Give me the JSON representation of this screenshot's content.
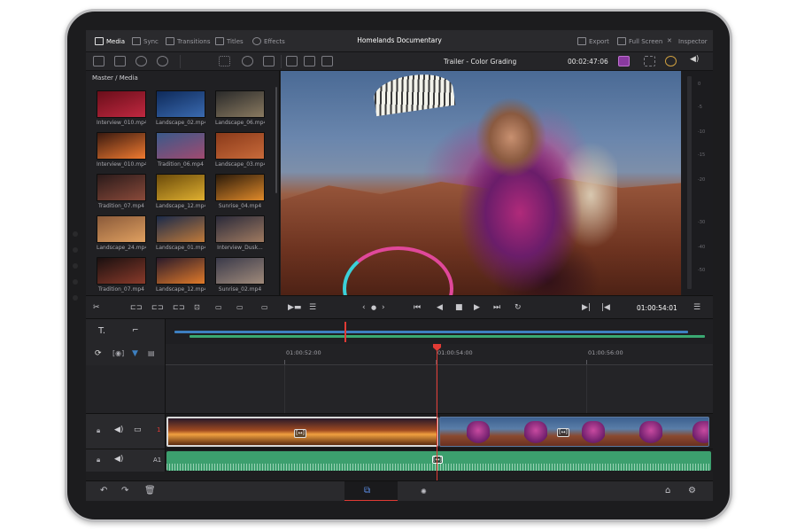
{
  "header": {
    "tabs": [
      {
        "label": "Media",
        "icon": "media-icon",
        "active": true
      },
      {
        "label": "Sync",
        "icon": "sync-icon"
      },
      {
        "label": "Transitions",
        "icon": "transitions-icon"
      },
      {
        "label": "Titles",
        "icon": "titles-icon"
      },
      {
        "label": "Effects",
        "icon": "effects-icon"
      }
    ],
    "project_title": "Homelands Documentary",
    "actions": [
      {
        "label": "Export",
        "icon": "export-icon"
      },
      {
        "label": "Full Screen",
        "icon": "fullscreen-icon"
      },
      {
        "label": "Inspector",
        "icon": "inspector-icon"
      }
    ]
  },
  "viewer": {
    "timeline_name": "Trailer - Color Grading",
    "duration": "00:02:47:06",
    "current_timecode": "01:00:54:01"
  },
  "media_pool": {
    "breadcrumb": "Master / Media",
    "clips": [
      {
        "name": "Interview_010.mp4",
        "colors": [
          "#6a0e1a",
          "#c02840"
        ]
      },
      {
        "name": "Landscape_02.mp4",
        "colors": [
          "#0e2a5a",
          "#3a6ab0"
        ]
      },
      {
        "name": "Landscape_06.mp4",
        "colors": [
          "#2a2a2a",
          "#8a7a60"
        ]
      },
      {
        "name": "Interview_010.mp4",
        "colors": [
          "#3a1a10",
          "#f07a30"
        ]
      },
      {
        "name": "Tradition_06.mp4",
        "colors": [
          "#3a5a8a",
          "#a04a70"
        ]
      },
      {
        "name": "Landscape_03.mp4",
        "colors": [
          "#8a3a1a",
          "#c86a3a"
        ]
      },
      {
        "name": "Tradition_07.mp4",
        "colors": [
          "#2a1a1a",
          "#8a4a3a"
        ]
      },
      {
        "name": "Landscape_12.mp4",
        "colors": [
          "#6a4a0a",
          "#e0b030"
        ]
      },
      {
        "name": "Sunrise_04.mp4",
        "colors": [
          "#2a1a0a",
          "#e08a2a"
        ]
      },
      {
        "name": "Landscape_24.mp4",
        "colors": [
          "#8a5a3a",
          "#e0a060"
        ]
      },
      {
        "name": "Landscape_01.mp4",
        "colors": [
          "#1a2a4a",
          "#c07a3a"
        ]
      },
      {
        "name": "Interview_Dusk...",
        "colors": [
          "#2a2a3a",
          "#a07a60"
        ]
      },
      {
        "name": "Tradition_07.mp4",
        "colors": [
          "#1a1010",
          "#8a3a2a"
        ]
      },
      {
        "name": "Landscape_12.mp4",
        "colors": [
          "#2a1a2a",
          "#e07a2a"
        ]
      },
      {
        "name": "Sunrise_02.mp4",
        "colors": [
          "#3a3a4a",
          "#a08a7a"
        ]
      }
    ]
  },
  "meter": {
    "labels": [
      "0",
      "-5",
      "-10",
      "-15",
      "-20",
      "-30",
      "-40",
      "-50"
    ]
  },
  "timeline": {
    "ruler": [
      "01:00:52:00",
      "01:00:54:00",
      "01:00:56:00"
    ],
    "video_track_label": "1",
    "audio_track_label": "A1",
    "transition_glyph": "[↔]"
  },
  "controls": {
    "prev_glyph": "‹",
    "next_glyph": "›",
    "dot_glyph": "●"
  },
  "colors": {
    "accent": "#e23b35",
    "video_clip_border": "#d8d8d8",
    "audio_clip": "#3c9f6e",
    "mini_blue": "#3d7fc0"
  }
}
